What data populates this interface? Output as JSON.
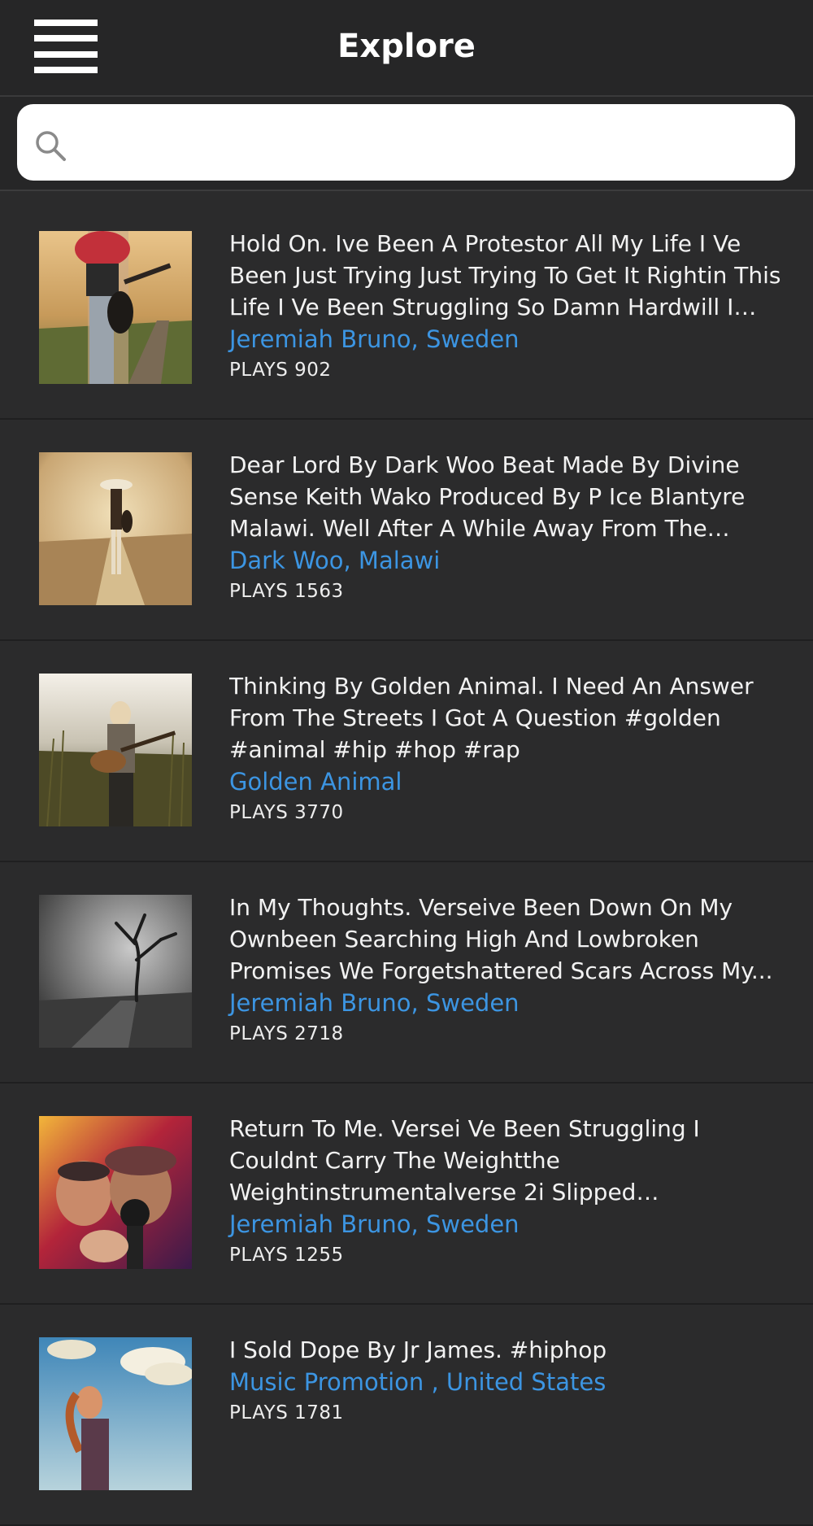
{
  "header": {
    "title": "Explore",
    "menu_icon": "hamburger-menu-icon"
  },
  "search": {
    "placeholder": "",
    "value": "",
    "icon": "search-icon"
  },
  "plays_label": "PLAYS",
  "tracks": [
    {
      "description": "Hold On. Ive Been A Protestor All My Life I Ve Been Just Trying Just Trying To Get It Rightin This Life I Ve Been Struggling So Damn Hardwill I Ev...",
      "artist": "Jeremiah Bruno, Sweden",
      "plays": "PLAYS 902"
    },
    {
      "description": "Dear Lord By Dark Woo Beat Made By Divine Sense Keith Wako Produced By P Ice Blantyre Malawi. Well After A While Away From The Musi...",
      "artist": "Dark Woo, Malawi",
      "plays": "PLAYS 1563"
    },
    {
      "description": "Thinking By Golden Animal. I Need An Answer From The Streets I Got A Question  #golden #animal #hip #hop #rap",
      "artist": "Golden Animal",
      "plays": "PLAYS 3770"
    },
    {
      "description": "In My Thoughts. Verseive Been Down On My Ownbeen Searching High And Lowbroken Promises We Forgetshattered Scars Across My...",
      "artist": "Jeremiah Bruno, Sweden",
      "plays": "PLAYS 2718"
    },
    {
      "description": "Return To Me. Versei Ve Been Struggling I Couldnt Carry The Weightthe Weightinstrumentalverse 2i Slipped Awayguess...",
      "artist": "Jeremiah Bruno, Sweden",
      "plays": "PLAYS 1255"
    },
    {
      "description": "I Sold Dope By Jr James.  #hiphop",
      "artist": "Music  Promotion , United States",
      "plays": "PLAYS 1781"
    }
  ],
  "colors": {
    "background": "#2b2b2c",
    "header": "#262627",
    "link": "#3c95e2",
    "text": "#f2f2f2"
  }
}
